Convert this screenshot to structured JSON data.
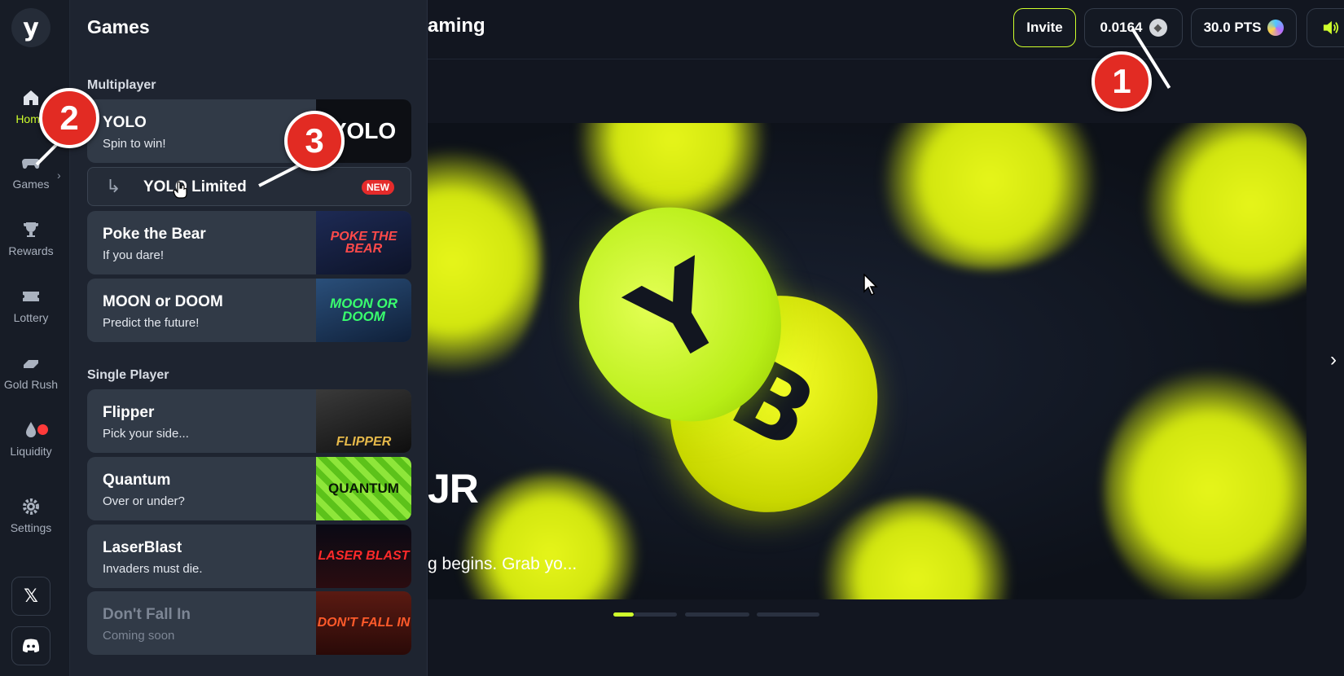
{
  "sidebar": {
    "logo": "y",
    "items": [
      {
        "label": "Home",
        "icon": "home-icon"
      },
      {
        "label": "Games",
        "icon": "gamepad-icon"
      },
      {
        "label": "Rewards",
        "icon": "trophy-icon"
      },
      {
        "label": "Lottery",
        "icon": "ticket-icon"
      },
      {
        "label": "Gold Rush",
        "icon": "gold-bar-icon"
      },
      {
        "label": "Liquidity",
        "icon": "drop-icon"
      },
      {
        "label": "Settings",
        "icon": "gear-icon"
      }
    ],
    "social": [
      {
        "label": "X",
        "icon": "x-logo-icon"
      },
      {
        "label": "Discord",
        "icon": "discord-icon"
      }
    ]
  },
  "panel": {
    "title": "Games",
    "multiplayer_heading": "Multiplayer",
    "single_heading": "Single Player",
    "yolo": {
      "title": "YOLO",
      "subtitle": "Spin to win!",
      "thumb": "YOLO"
    },
    "yolo_limited": {
      "title": "YOLO Limited",
      "badge": "NEW"
    },
    "poke": {
      "title": "Poke the Bear",
      "subtitle": "If you dare!",
      "thumb": "POKE THE BEAR"
    },
    "moon": {
      "title": "MOON or DOOM",
      "subtitle": "Predict the future!",
      "thumb": "MOON OR DOOM"
    },
    "flipper": {
      "title": "Flipper",
      "subtitle": "Pick your side...",
      "thumb": "FLIPPER"
    },
    "quantum": {
      "title": "Quantum",
      "subtitle": "Over or under?",
      "thumb": "QUANTUM"
    },
    "laser": {
      "title": "LaserBlast",
      "subtitle": "Invaders must die.",
      "thumb": "LASER BLAST"
    },
    "dontfall": {
      "title": "Don't Fall In",
      "subtitle": "Coming soon",
      "thumb": "DON'T FALL IN"
    }
  },
  "header": {
    "title_partial": "aming",
    "invite": "Invite",
    "eth_balance": "0.0164",
    "points": "30.0 PTS"
  },
  "hero": {
    "headline_partial": "JR",
    "subline_partial": "g begins. Grab yo...",
    "coin1": "Y",
    "coin2": "B"
  },
  "annotations": [
    "1",
    "2",
    "3"
  ],
  "colors": {
    "accent": "#cfff2c",
    "badge": "#e52b2b",
    "annotation": "#e22b23"
  }
}
